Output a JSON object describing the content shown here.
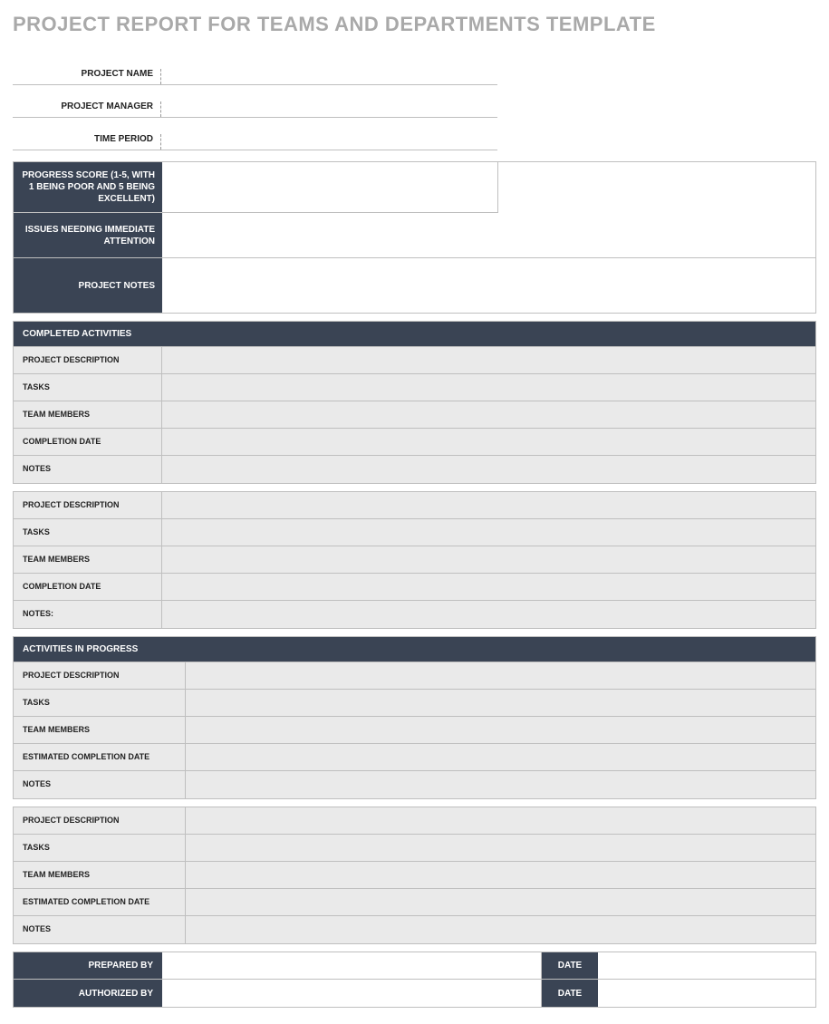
{
  "title": "PROJECT REPORT FOR TEAMS AND DEPARTMENTS TEMPLATE",
  "header": {
    "project_name_label": "PROJECT NAME",
    "project_name_value": "",
    "project_manager_label": "PROJECT MANAGER",
    "project_manager_value": "",
    "time_period_label": "TIME PERIOD",
    "time_period_value": ""
  },
  "info": {
    "progress_score_label": "PROGRESS SCORE (1-5, WITH 1 BEING POOR AND 5 BEING EXCELLENT)",
    "progress_score_value": "",
    "issues_label": "ISSUES NEEDING IMMEDIATE ATTENTION",
    "issues_value": "",
    "notes_label": "PROJECT NOTES",
    "notes_value": ""
  },
  "completed": {
    "section_label": "COMPLETED ACTIVITIES",
    "groups": [
      {
        "project_description_label": "PROJECT DESCRIPTION",
        "project_description_value": "",
        "tasks_label": "TASKS",
        "tasks_value": "",
        "team_members_label": "TEAM MEMBERS",
        "team_members_value": "",
        "completion_date_label": "COMPLETION DATE",
        "completion_date_value": "",
        "notes_label": "NOTES",
        "notes_value": ""
      },
      {
        "project_description_label": "PROJECT DESCRIPTION",
        "project_description_value": "",
        "tasks_label": "TASKS",
        "tasks_value": "",
        "team_members_label": "TEAM MEMBERS",
        "team_members_value": "",
        "completion_date_label": "COMPLETION DATE",
        "completion_date_value": "",
        "notes_label": "NOTES:",
        "notes_value": ""
      }
    ]
  },
  "in_progress": {
    "section_label": "ACTIVITIES IN PROGRESS",
    "groups": [
      {
        "project_description_label": "PROJECT DESCRIPTION",
        "project_description_value": "",
        "tasks_label": "TASKS",
        "tasks_value": "",
        "team_members_label": "TEAM MEMBERS",
        "team_members_value": "",
        "est_completion_label": "ESTIMATED COMPLETION DATE",
        "est_completion_value": "",
        "notes_label": "NOTES",
        "notes_value": ""
      },
      {
        "project_description_label": "PROJECT DESCRIPTION",
        "project_description_value": "",
        "tasks_label": "TASKS",
        "tasks_value": "",
        "team_members_label": "TEAM MEMBERS",
        "team_members_value": "",
        "est_completion_label": "ESTIMATED COMPLETION DATE",
        "est_completion_value": "",
        "notes_label": "NOTES",
        "notes_value": ""
      }
    ]
  },
  "sign": {
    "prepared_by_label": "PREPARED BY",
    "prepared_by_value": "",
    "authorized_by_label": "AUTHORIZED BY",
    "authorized_by_value": "",
    "date_label": "DATE",
    "prepared_date_value": "",
    "authorized_date_value": ""
  }
}
